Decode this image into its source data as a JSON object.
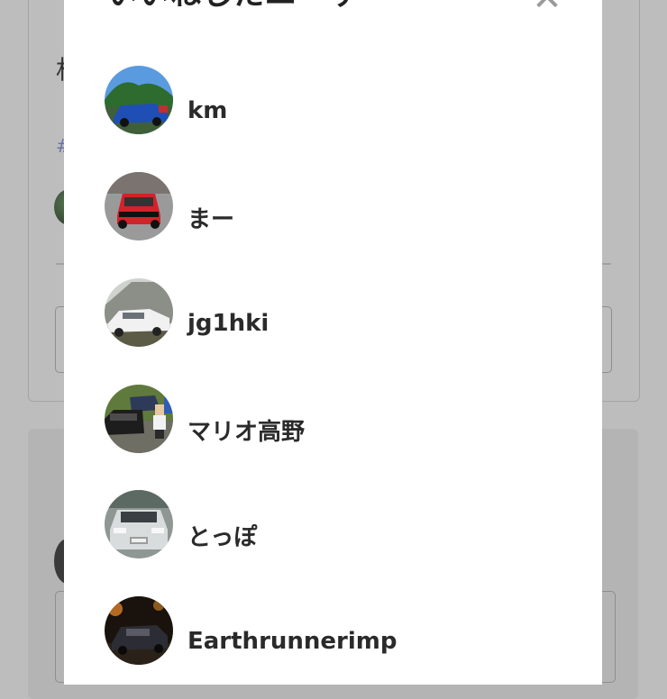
{
  "modal": {
    "title": "いいねしたユーザー",
    "close_icon": "close-icon",
    "users": [
      {
        "name": "km",
        "avatar": "avatar-photo-blue-car-mountain"
      },
      {
        "name": "まー",
        "avatar": "avatar-photo-red-car"
      },
      {
        "name": "jg1hki",
        "avatar": "avatar-photo-white-sedan-garage"
      },
      {
        "name": "マリオ高野",
        "avatar": "avatar-photo-person-with-cars"
      },
      {
        "name": "とっぽ",
        "avatar": "avatar-photo-silver-car-front"
      },
      {
        "name": "Earthrunnerimp",
        "avatar": "avatar-photo-car-at-night"
      }
    ]
  },
  "background": {
    "text_fragment": "机",
    "hashtag_fragment": "#"
  }
}
